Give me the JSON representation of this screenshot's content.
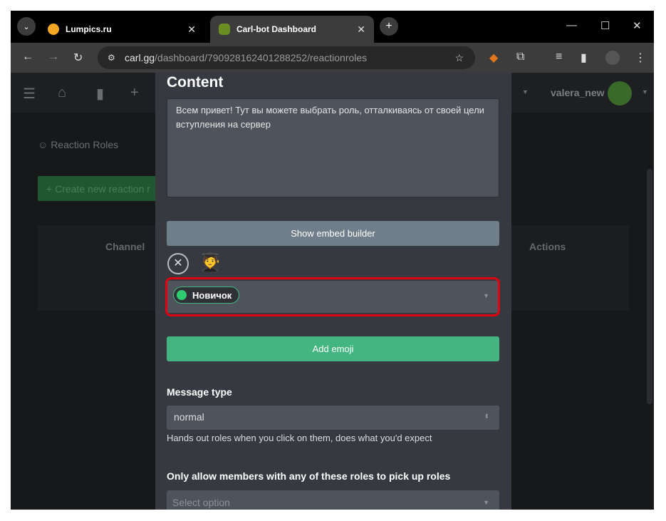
{
  "browser": {
    "tabs": [
      {
        "title": "Lumpics.ru",
        "favicon_color": "#f5a623"
      },
      {
        "title": "Carl-bot Dashboard",
        "favicon_color": "#6b8e23",
        "active": true
      }
    ],
    "url_host": "carl.gg",
    "url_path": "/dashboard/790928162401288252/reactionroles"
  },
  "nav": {
    "username": "valera_new"
  },
  "background": {
    "section_title": "Reaction Roles",
    "create_button": "Create new reaction r",
    "columns": [
      "Channel",
      "Actions"
    ]
  },
  "modal": {
    "content_label": "Content",
    "message": "Всем привет! Тут вы можете выбрать роль, отталкиваясь от своей цели вступления на сервер",
    "embed_button": "Show embed builder",
    "emoji": "🧑‍🎓",
    "role": {
      "name": "Новичок",
      "color": "#2ecc71"
    },
    "add_emoji_button": "Add emoji",
    "message_type_label": "Message type",
    "message_type_value": "normal",
    "message_type_help": "Hands out roles when you click on them, does what you'd expect",
    "only_allow_label": "Only allow members with any of these roles to pick up roles",
    "only_allow_placeholder": "Select option"
  },
  "colors": {
    "accent_green": "#43b581",
    "highlight_red": "#e0000f"
  }
}
